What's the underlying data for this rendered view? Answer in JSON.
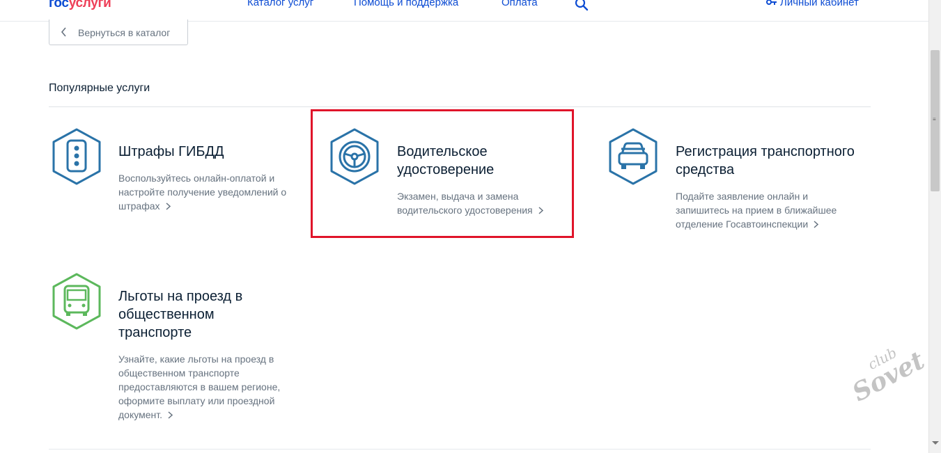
{
  "header": {
    "logo_part1": "гос",
    "logo_part2": "услуги",
    "nav": [
      "Каталог услуг",
      "Помощь и поддержка",
      "Оплата"
    ],
    "search_icon": "search-icon",
    "cabinet_label": "Личный кабинет",
    "cabinet_icon": "key-icon"
  },
  "back_button": {
    "label": "Вернуться в каталог",
    "icon": "chevron-left-icon"
  },
  "section_title": "Популярные услуги",
  "cards": [
    {
      "title": "Штрафы ГИБДД",
      "desc": "Воспользуйтесь онлайн-оплатой и настройте получение уведомлений о штрафах",
      "icon": "traffic-light-icon"
    },
    {
      "title": "Водительское удостоверение",
      "desc": "Экзамен, выдача и замена водительского удостоверения",
      "icon": "steering-wheel-icon"
    },
    {
      "title": "Регистрация транспортного средства",
      "desc": "Подайте заявление онлайн и запишитесь на прием в ближайшее отделение Госавтоинспекции",
      "icon": "car-icon"
    },
    {
      "title": "Льготы на проезд в общественном транспорте",
      "desc": "Узнайте, какие льготы на проезд в общественном транспорте предоставляются в вашем регионе, оформите выплату или проездной документ.",
      "icon": "bus-icon"
    }
  ],
  "watermark": {
    "line1": "club",
    "line2": "Sovet"
  },
  "colors": {
    "brand_blue": "#0d4cd3",
    "brand_red": "#ee3f58",
    "icon_blue": "#2a73a8",
    "icon_green": "#5cb85c",
    "highlight": "#e0142a"
  }
}
